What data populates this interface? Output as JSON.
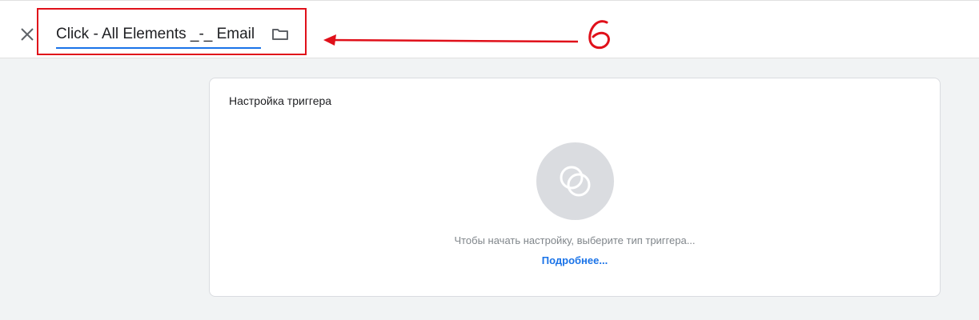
{
  "header": {
    "close_icon": "close-icon",
    "trigger_name": "Click - All Elements _-_ Email",
    "folder_icon": "folder-icon"
  },
  "annotation": {
    "label": "6",
    "color": "#e0101a"
  },
  "card": {
    "title": "Настройка триггера",
    "trigger_type_icon": "trigger-type-icon",
    "hint": "Чтобы начать настройку, выберите тип триггера...",
    "more_link": "Подробнее..."
  },
  "colors": {
    "accent": "#1a73e8",
    "annotation": "#e0101a",
    "background": "#f1f3f4"
  }
}
